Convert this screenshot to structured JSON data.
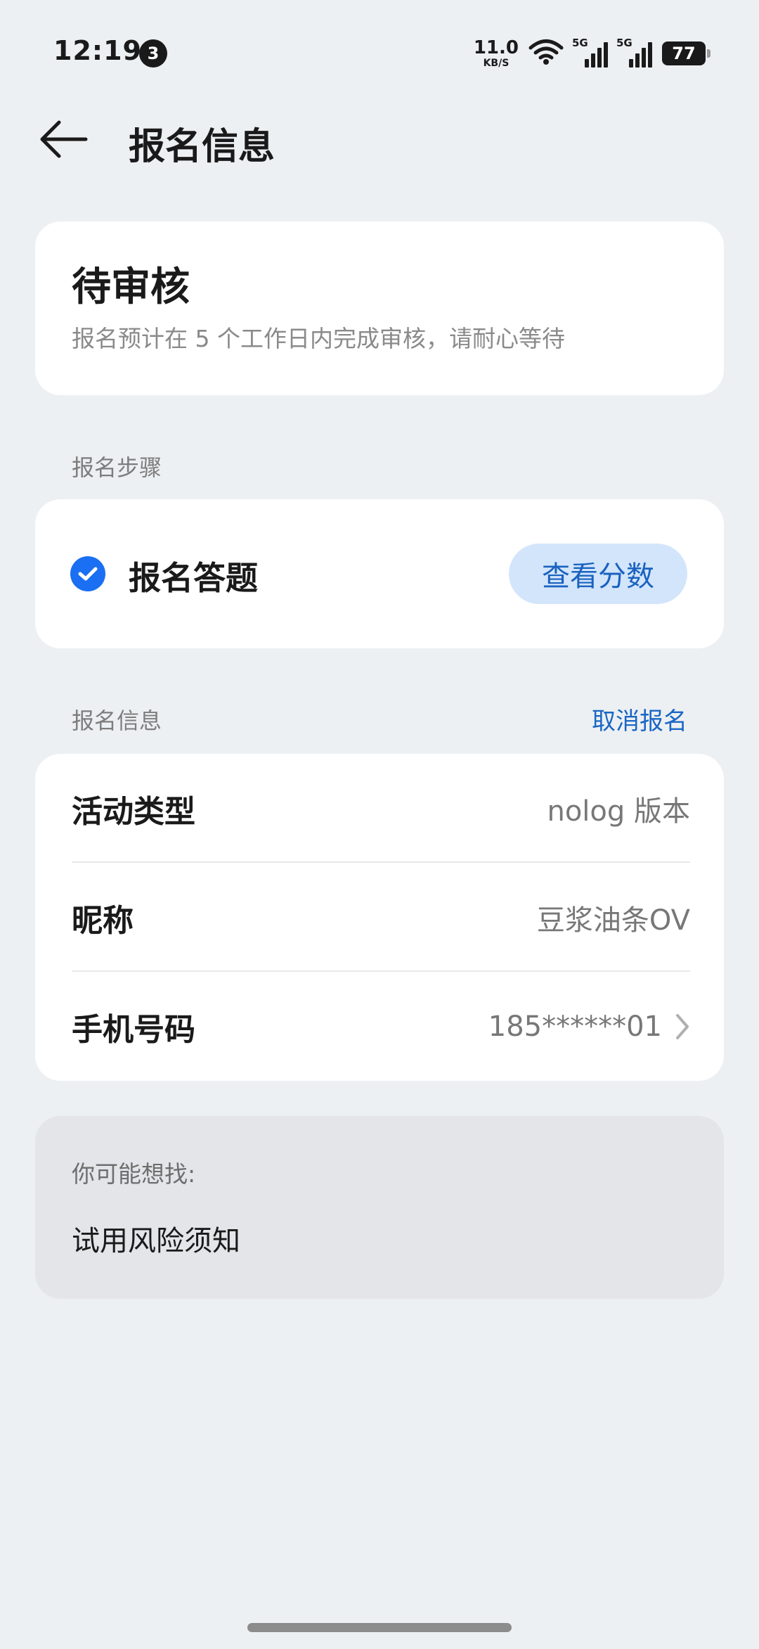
{
  "status_bar": {
    "time": "12:19",
    "notification_count": "3",
    "net_speed": "11.0",
    "net_speed_unit": "KB/S",
    "signal_1_label": "5G",
    "signal_2_label": "5G",
    "battery": "77"
  },
  "header": {
    "title": "报名信息"
  },
  "status_card": {
    "title": "待审核",
    "description": "报名预计在 5 个工作日内完成审核，请耐心等待"
  },
  "steps": {
    "section_label": "报名步骤",
    "step_label": "报名答题",
    "score_button": "查看分数"
  },
  "info": {
    "section_label": "报名信息",
    "cancel_label": "取消报名",
    "rows": [
      {
        "key": "活动类型",
        "value": "nolog 版本"
      },
      {
        "key": "昵称",
        "value": "豆浆油条OV"
      },
      {
        "key": "手机号码",
        "value": "185******01"
      }
    ]
  },
  "suggest": {
    "title": "你可能想找:",
    "item": "试用风险须知"
  },
  "colors": {
    "background": "#edf0f3",
    "accent": "#1a6ff2",
    "link": "#1a66c4",
    "score_button_bg": "#d3e5fb"
  }
}
